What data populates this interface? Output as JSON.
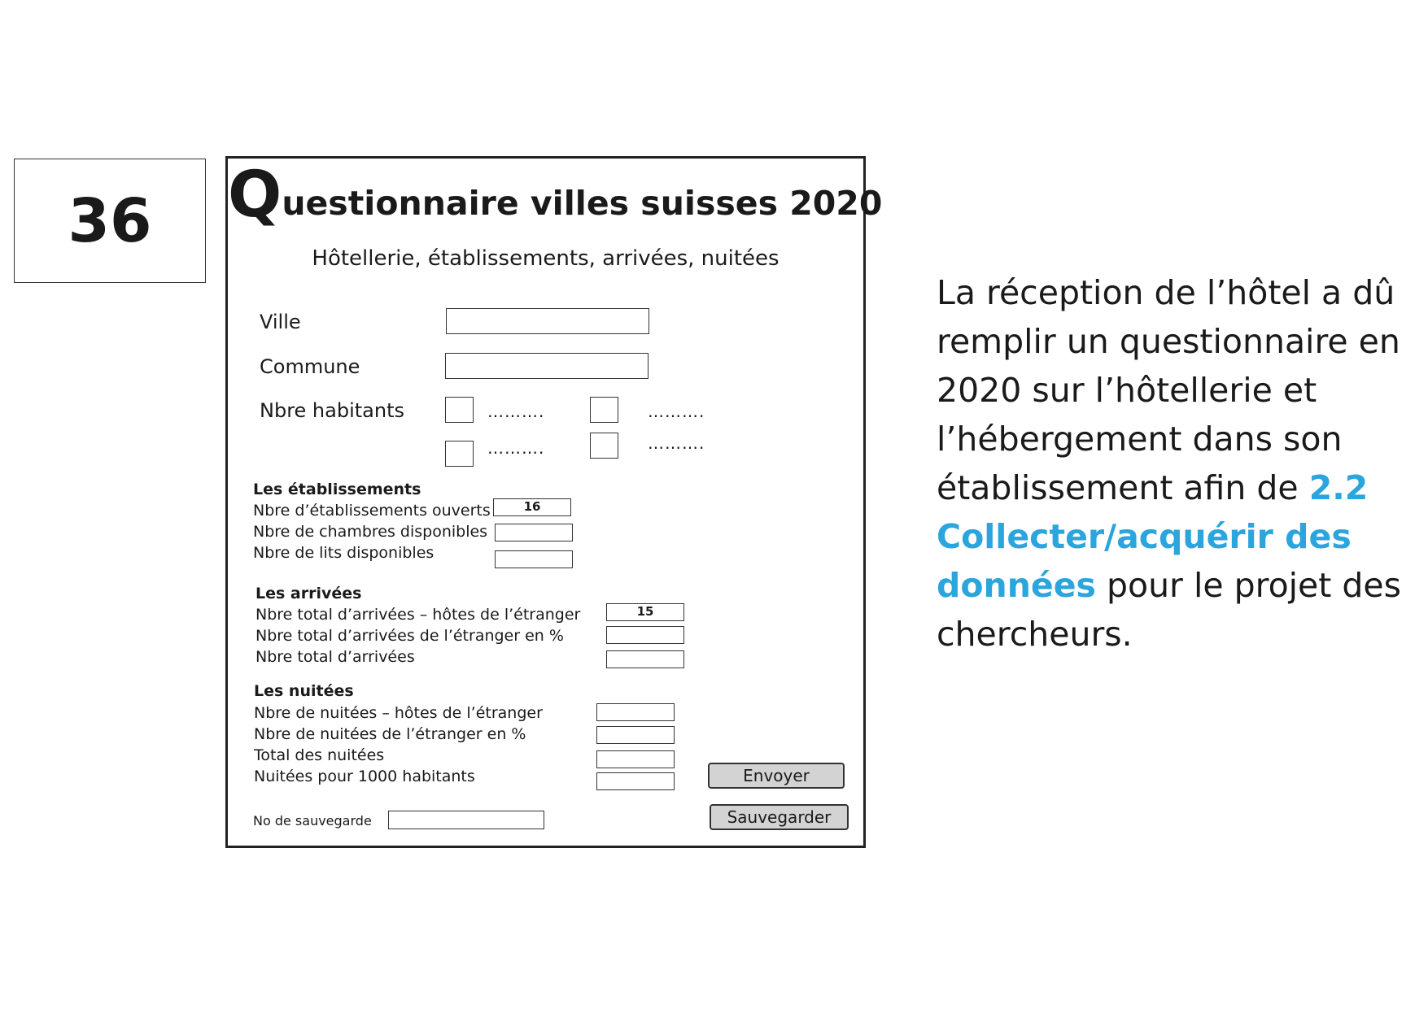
{
  "card_number": "36",
  "form": {
    "title_first_letter": "Q",
    "title_rest": "uestionnaire villes suisses 2020",
    "subtitle": "Hôtellerie, établissements, arrivées, nuitées",
    "ville_label": "Ville",
    "commune_label": "Commune",
    "habitants_label": "Nbre habitants",
    "habitants_options": [
      "……….",
      "……….",
      "……….",
      "………."
    ],
    "etablissements": {
      "title": "Les établissements",
      "ouverts_label": "Nbre d’établissements ouverts",
      "ouverts_value": "16",
      "chambres_label": "Nbre de chambres disponibles",
      "lits_label": "Nbre de lits disponibles"
    },
    "arrivees": {
      "title": "Les arrivées",
      "etranger_label": "Nbre total d’arrivées – hôtes de l’étranger",
      "etranger_value": "15",
      "pct_label": "Nbre total d’arrivées de l’étranger en %",
      "total_label": "Nbre total d’arrivées"
    },
    "nuitees": {
      "title": "Les nuitées",
      "etranger_label": "Nbre de nuitées – hôtes de l’étranger",
      "pct_label": "Nbre de nuitées de l’étranger en %",
      "total_label": "Total des nuitées",
      "per1000_label": "Nuitées pour 1000 habitants"
    },
    "save_no_label": "No de sauvegarde",
    "send_button": "Envoyer",
    "save_button": "Sauvegarder"
  },
  "description": {
    "text_before": "La réception de l’hôtel a dû remplir un questionnaire en 2020 sur l’hôtellerie et l’hébergement dans son établissement afin de ",
    "highlight": "2.2 Collecter/acquérir des données",
    "text_after": " pour le projet des chercheurs."
  },
  "colors": {
    "highlight": "#2aa5dd",
    "button_bg": "#d3d3d3",
    "border": "#333333"
  }
}
